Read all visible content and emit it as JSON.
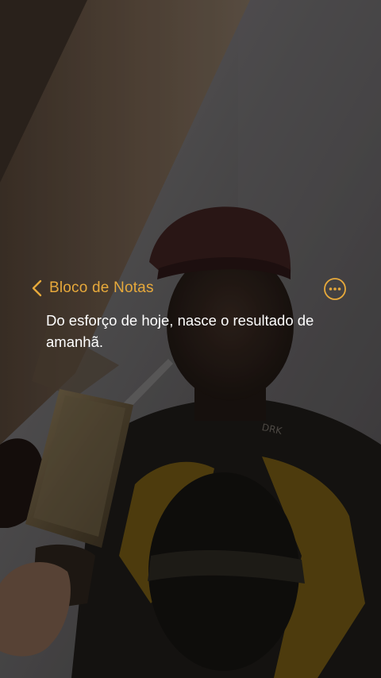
{
  "app": {
    "back_label": "Bloco de Notas",
    "back_icon": "chevron-left-icon",
    "more_icon": "ellipsis-circle-icon",
    "accent_color": "#e7a93b"
  },
  "note": {
    "text": "Do esforço de hoje, nasce o resultado de amanhã."
  }
}
